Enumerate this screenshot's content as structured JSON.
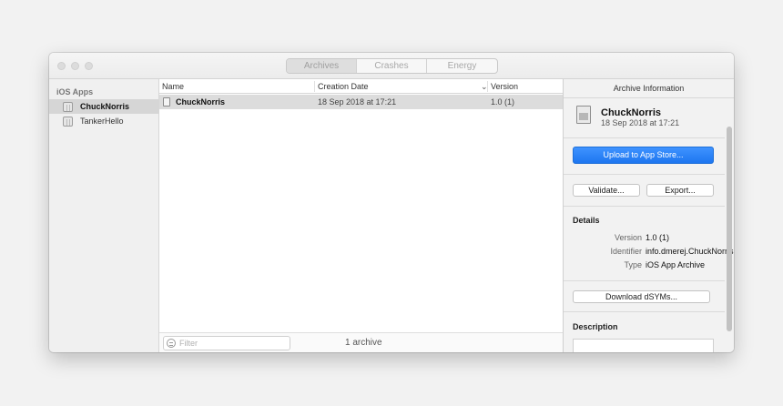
{
  "toolbar": {
    "tabs": [
      {
        "label": "Archives"
      },
      {
        "label": "Crashes"
      },
      {
        "label": "Energy"
      }
    ]
  },
  "sidebar": {
    "header": "iOS Apps",
    "items": [
      {
        "label": "ChuckNorris"
      },
      {
        "label": "TankerHello"
      }
    ]
  },
  "list": {
    "columns": {
      "name": "Name",
      "creation_date": "Creation Date",
      "version": "Version"
    },
    "sort_indicator": "⌄",
    "rows": [
      {
        "name": "ChuckNorris",
        "creation_date": "18 Sep 2018 at 17:21",
        "version": "1.0 (1)"
      }
    ],
    "filter_placeholder": "Filter",
    "count": "1 archive"
  },
  "inspector": {
    "title": "Archive Information",
    "archive_name": "ChuckNorris",
    "archive_date": "18 Sep 2018 at 17:21",
    "upload_label": "Upload to App Store...",
    "validate_label": "Validate...",
    "export_label": "Export...",
    "details_title": "Details",
    "details": {
      "version_key": "Version",
      "version_val": "1.0 (1)",
      "identifier_key": "Identifier",
      "identifier_val": "info.dmerej.ChuckNorris",
      "type_key": "Type",
      "type_val": "iOS App Archive"
    },
    "download_dsyms_label": "Download dSYMs...",
    "description_title": "Description"
  },
  "colors": {
    "accent": "#2483f7",
    "selection": "#dcdcdc"
  }
}
